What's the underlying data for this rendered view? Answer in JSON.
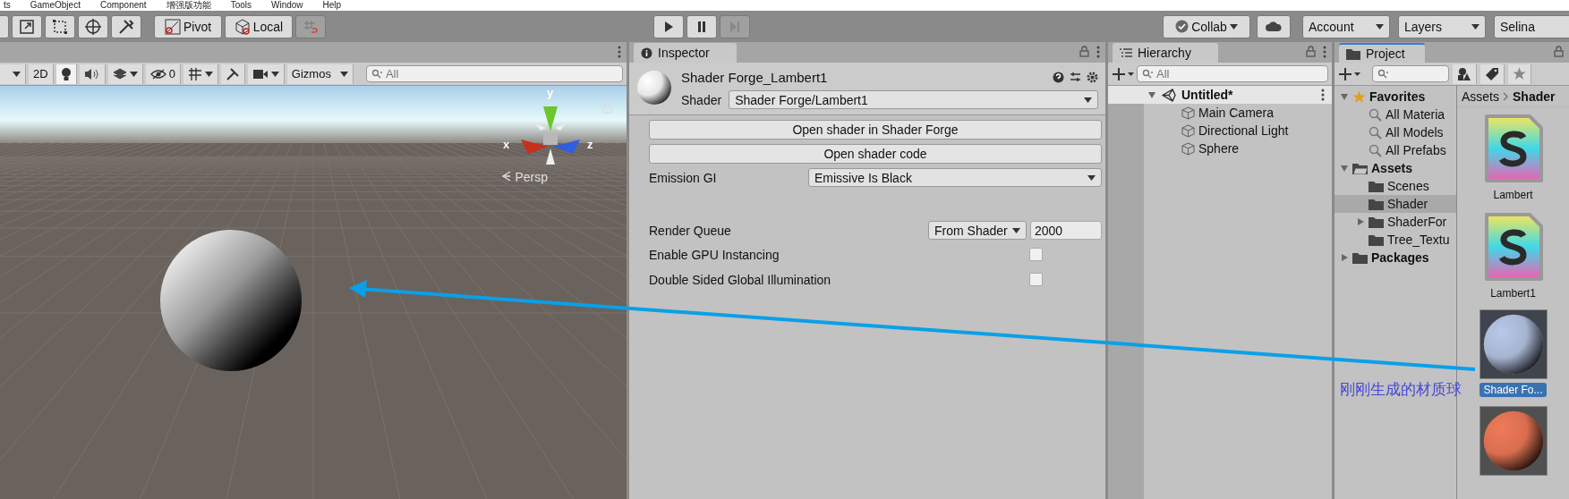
{
  "menu_bar": [
    "ts",
    "GameObject",
    "Component",
    "增强版功能",
    "Tools",
    "Window",
    "Help"
  ],
  "toolbar": {
    "pivot": "Pivot",
    "local": "Local",
    "snap": {
      "disabled": true
    },
    "playback": [
      {
        "kind": "play",
        "disabled": false
      },
      {
        "kind": "pause",
        "disabled": false
      },
      {
        "kind": "step",
        "disabled": true
      }
    ],
    "collab": "Collab",
    "account": "Account",
    "layers": "Layers",
    "user": "Selina"
  },
  "scene": {
    "toolbar": {
      "mode": "2D",
      "lighting_on": true,
      "hidden_count": "0",
      "gizmos": "Gizmos",
      "search_placeholder": "All"
    },
    "axes": {
      "x": "x",
      "y": "y",
      "z": "z"
    },
    "view_label": "Persp"
  },
  "inspector": {
    "tab": "Inspector",
    "title": "Shader Forge_Lambert1",
    "shader_label": "Shader",
    "shader_value": "Shader Forge/Lambert1",
    "buttons": [
      "Open shader in Shader Forge",
      "Open shader code"
    ],
    "emission": {
      "label": "Emission GI",
      "value": "Emissive Is Black"
    },
    "render_queue": {
      "label": "Render Queue",
      "mode": "From Shader",
      "value": "2000"
    },
    "toggles": [
      {
        "label": "Enable GPU Instancing",
        "checked": false
      },
      {
        "label": "Double Sided Global Illumination",
        "checked": false
      }
    ]
  },
  "hierarchy": {
    "tab": "Hierarchy",
    "search_placeholder": "All",
    "scene": {
      "name": "Untitled*",
      "expanded": true,
      "children": [
        {
          "name": "Main Camera"
        },
        {
          "name": "Directional Light"
        },
        {
          "name": "Sphere"
        }
      ]
    }
  },
  "project": {
    "tab": "Project",
    "tree": [
      {
        "name": "Favorites",
        "kind": "favorites",
        "expanded": true,
        "selected": false,
        "children": [
          {
            "name": "All Materia",
            "kind": "search",
            "selected": false
          },
          {
            "name": "All Models",
            "kind": "search",
            "selected": false
          },
          {
            "name": "All Prefabs",
            "kind": "search",
            "selected": false
          }
        ]
      },
      {
        "name": "Assets",
        "kind": "root-folder",
        "expanded": true,
        "selected": false,
        "children": [
          {
            "name": "Scenes",
            "kind": "folder",
            "selected": false
          },
          {
            "name": "Shader",
            "kind": "folder",
            "selected": true
          },
          {
            "name": "ShaderFor",
            "kind": "folder",
            "expanded": false,
            "selected": false
          },
          {
            "name": "Tree_Textu",
            "kind": "folder",
            "selected": false
          }
        ]
      },
      {
        "name": "Packages",
        "kind": "root-folder",
        "expanded": false,
        "selected": false
      }
    ],
    "breadcrumb": [
      "Assets",
      "Shader"
    ],
    "assets": [
      {
        "name": "Lambert",
        "kind": "shader",
        "selected": false
      },
      {
        "name": "Lambert1",
        "kind": "shader",
        "selected": false
      },
      {
        "name": "Shader Fo...",
        "kind": "material",
        "color": "#b8c8e8",
        "selected": true
      },
      {
        "kind": "material",
        "color": "#f07a58",
        "selected": false
      }
    ]
  },
  "annotation": {
    "text": "刚刚生成的材质球"
  }
}
